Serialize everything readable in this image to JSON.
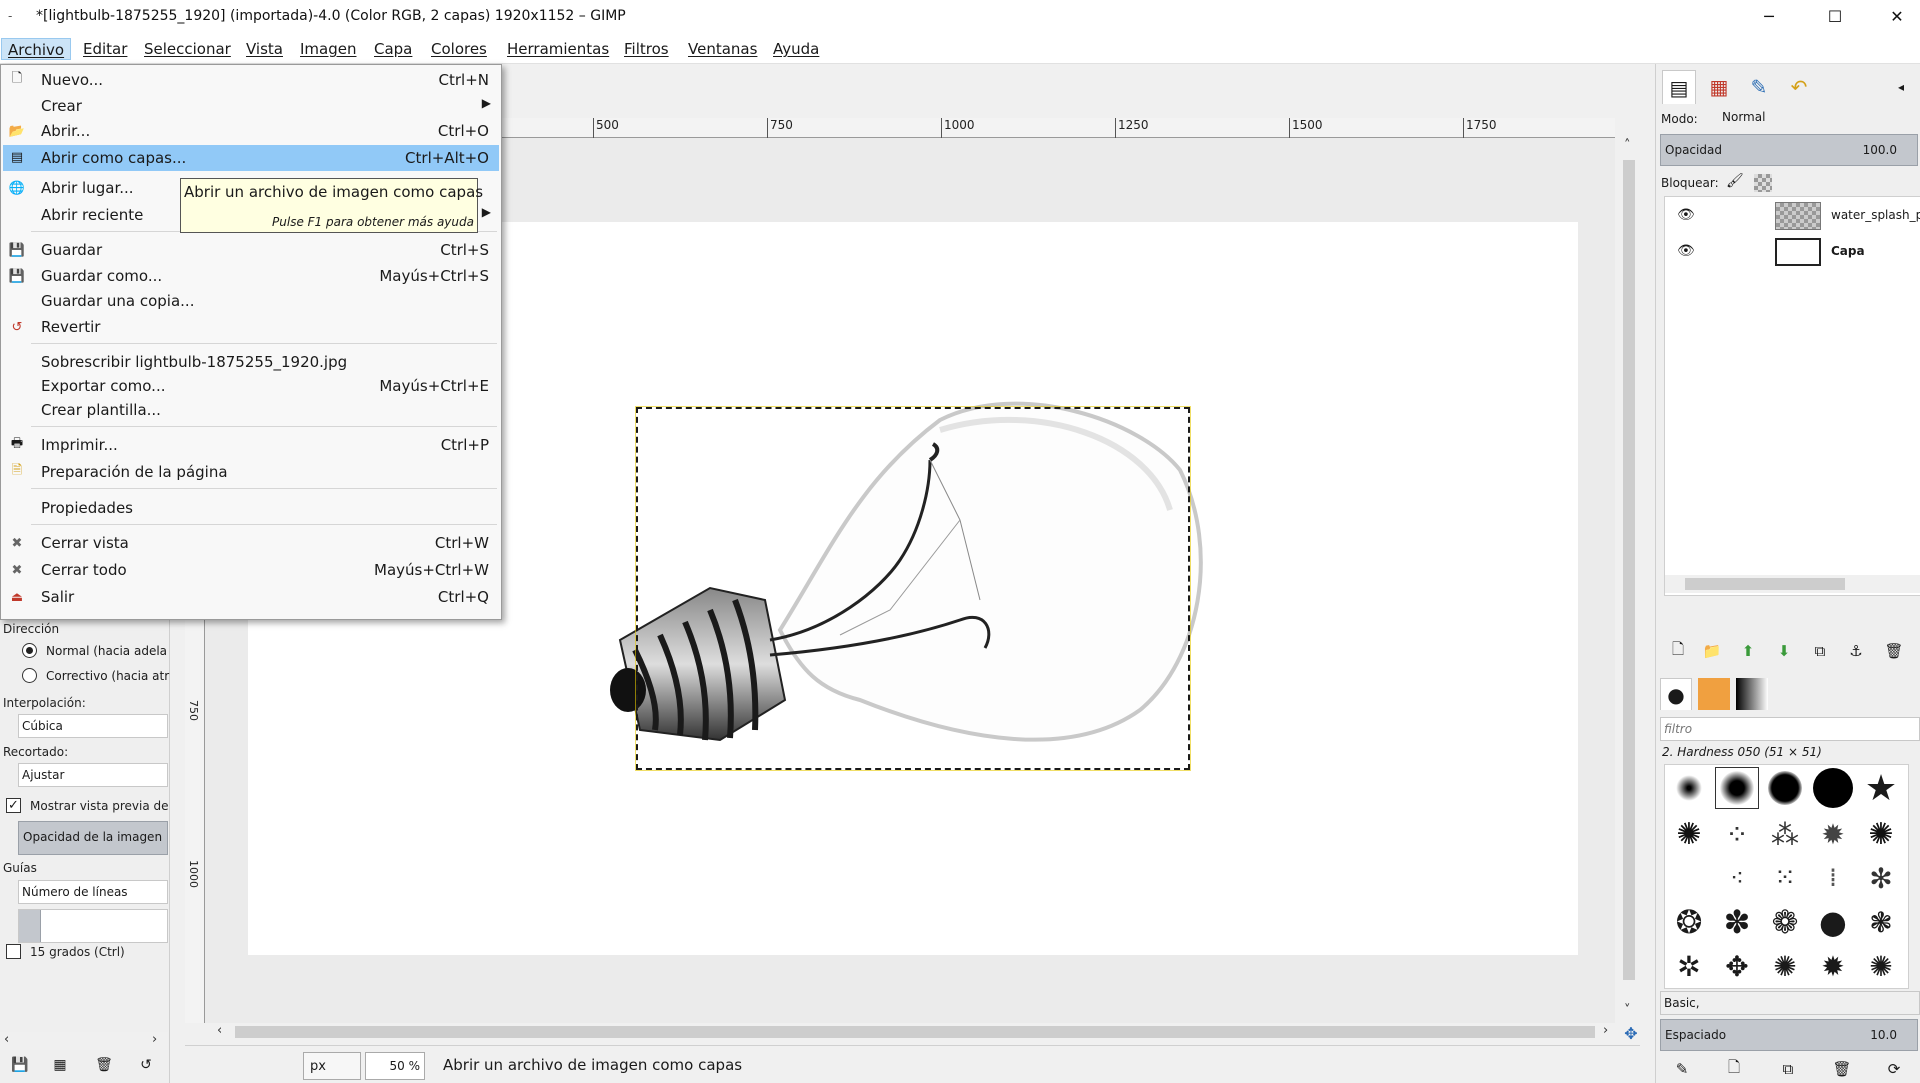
{
  "window": {
    "title": "*[lightbulb-1875255_1920] (importada)-4.0 (Color RGB, 2 capas) 1920x1152 – GIMP",
    "icon_glyph": "-",
    "minimize_glyph": "─",
    "maximize_glyph": "☐",
    "close_glyph": "✕"
  },
  "menubar": {
    "items": [
      "Archivo",
      "Editar",
      "Seleccionar",
      "Vista",
      "Imagen",
      "Capa",
      "Colores",
      "Herramientas",
      "Filtros",
      "Ventanas",
      "Ayuda"
    ],
    "active": "Archivo"
  },
  "file_menu": {
    "items": [
      {
        "label": "Nuevo...",
        "shortcut": "Ctrl+N",
        "icon": "new-document-icon"
      },
      {
        "label": "Crear",
        "shortcut": "",
        "submenu": true
      },
      {
        "label": "Abrir...",
        "shortcut": "Ctrl+O",
        "icon": "folder-open-icon"
      },
      {
        "label": "Abrir como capas...",
        "shortcut": "Ctrl+Alt+O",
        "icon": "open-as-layers-icon",
        "highlighted": true
      },
      {
        "label": "Abrir lugar...",
        "shortcut": "",
        "icon": "globe-icon"
      },
      {
        "label": "Abrir reciente",
        "shortcut": "",
        "submenu": true
      },
      {
        "label": "Guardar",
        "shortcut": "Ctrl+S",
        "icon": "save-icon"
      },
      {
        "label": "Guardar como...",
        "shortcut": "Mayús+Ctrl+S",
        "icon": "save-as-icon"
      },
      {
        "label": "Guardar una copia...",
        "shortcut": ""
      },
      {
        "label": "Revertir",
        "shortcut": "",
        "icon": "revert-icon"
      },
      {
        "label": "Sobrescribir lightbulb-1875255_1920.jpg",
        "shortcut": ""
      },
      {
        "label": "Exportar como...",
        "shortcut": "Mayús+Ctrl+E"
      },
      {
        "label": "Crear plantilla...",
        "shortcut": ""
      },
      {
        "label": "Imprimir...",
        "shortcut": "Ctrl+P",
        "icon": "printer-icon"
      },
      {
        "label": "Preparación de la página",
        "shortcut": "",
        "icon": "page-setup-icon"
      },
      {
        "label": "Propiedades",
        "shortcut": ""
      },
      {
        "label": "Cerrar vista",
        "shortcut": "Ctrl+W",
        "icon": "close-view-icon"
      },
      {
        "label": "Cerrar todo",
        "shortcut": "Mayús+Ctrl+W",
        "icon": "close-all-icon"
      },
      {
        "label": "Salir",
        "shortcut": "Ctrl+Q",
        "icon": "quit-icon"
      }
    ]
  },
  "tooltip": {
    "text": "Abrir un archivo de imagen como capas",
    "hint": "Pulse F1 para obtener más ayuda"
  },
  "tool_options": {
    "direction_label": "Dirección",
    "direction_normal": "Normal (hacia adela",
    "direction_corrective": "Correctivo (hacia atr",
    "interpolation_label": "Interpolación:",
    "interpolation_value": "Cúbica",
    "clipping_label": "Recortado:",
    "clipping_value": "Ajustar",
    "show_preview_label": "Mostrar vista previa de",
    "image_opacity_label": "Opacidad de la imagen",
    "guides_label": "Guías",
    "guides_value": "Número de líneas",
    "fifteen_deg_label": "15 grados  (Ctrl)"
  },
  "rulers": {
    "h_ticks": [
      "500",
      "750",
      "1000",
      "1250",
      "1500",
      "1750"
    ],
    "v_ticks": [
      "750",
      "1000"
    ]
  },
  "statusbar": {
    "unit": "px",
    "zoom": "50 %",
    "message": "Abrir un archivo de imagen como capas"
  },
  "layers_panel": {
    "mode_label": "Modo:",
    "mode_value": "Normal",
    "opacity_label": "Opacidad",
    "opacity_value": "100.0",
    "lock_label": "Bloquear:",
    "layers": [
      {
        "name": "water_splash_png",
        "visible": true,
        "bold": false
      },
      {
        "name": "Capa",
        "visible": true,
        "bold": true
      }
    ]
  },
  "brushes_panel": {
    "filter_placeholder": "filtro",
    "selected_brush": "2. Hardness 050 (51 × 51)",
    "preset": "Basic,",
    "spacing_label": "Espaciado",
    "spacing_value": "10.0"
  },
  "colors": {
    "menu_highlight": "#91c9f7",
    "tooltip_bg": "#ffffe1",
    "selection": "#e6c800"
  }
}
